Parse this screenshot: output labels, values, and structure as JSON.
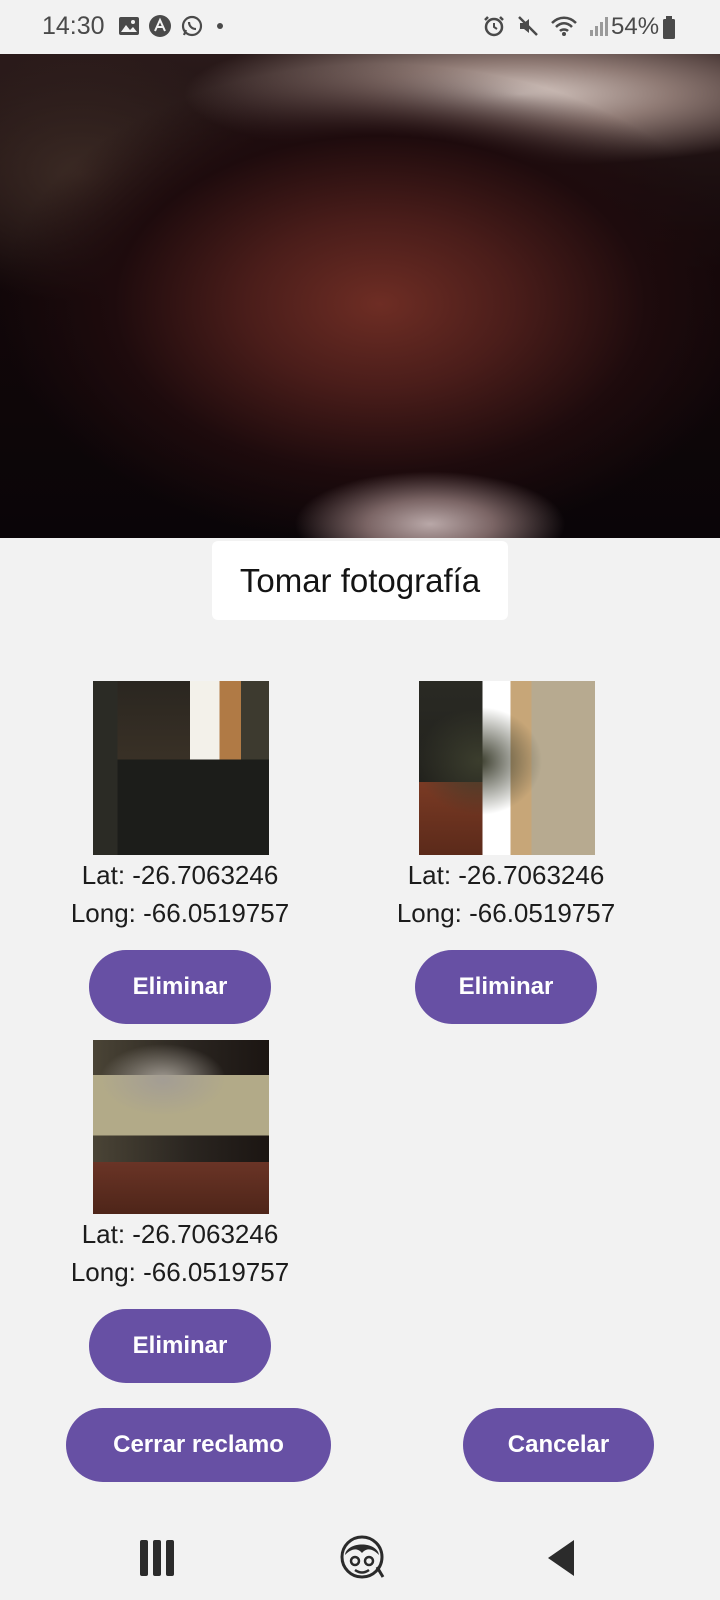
{
  "status_bar": {
    "time": "14:30",
    "battery_percent": "54%",
    "icons_left": [
      "gallery-icon",
      "a-badge-icon",
      "whatsapp-icon",
      "dot-icon"
    ],
    "icons_right": [
      "alarm-icon",
      "mute-icon",
      "wifi-icon",
      "signal-icon",
      "battery-icon"
    ]
  },
  "camera": {
    "take_photo_label": "Tomar fotografía"
  },
  "photos": [
    {
      "lat": "Lat: -26.7063246",
      "long": "Long: -66.0519757",
      "delete_label": "Eliminar"
    },
    {
      "lat": "Lat: -26.7063246",
      "long": "Long: -66.0519757",
      "delete_label": "Eliminar"
    },
    {
      "lat": "Lat: -26.7063246",
      "long": "Long: -66.0519757",
      "delete_label": "Eliminar"
    }
  ],
  "actions": {
    "close_claim_label": "Cerrar reclamo",
    "cancel_label": "Cancelar"
  },
  "nav_bar": {
    "icons": [
      "recents-icon",
      "home-assistant-icon",
      "back-icon"
    ]
  },
  "colors": {
    "accent": "#6750a4",
    "background": "#f2f2f2"
  }
}
